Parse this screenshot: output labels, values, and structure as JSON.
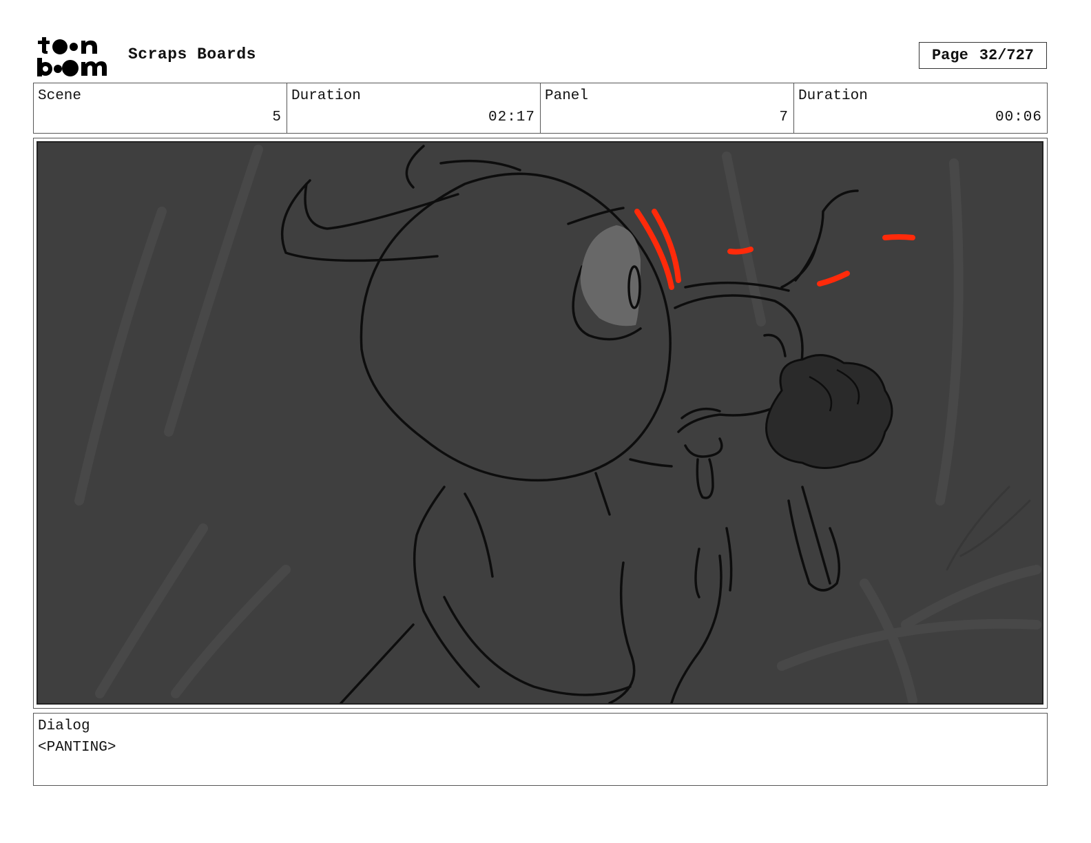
{
  "header": {
    "logo_text_top": "toon",
    "logo_text_bottom": "boom",
    "project_title": "Scraps Boards",
    "page_label": "Page",
    "page_value": "32/727"
  },
  "info": {
    "scene_label": "Scene",
    "scene_value": "5",
    "scene_duration_label": "Duration",
    "scene_duration_value": "02:17",
    "panel_label": "Panel",
    "panel_value": "7",
    "panel_duration_label": "Duration",
    "panel_duration_value": "00:06"
  },
  "dialog": {
    "label": "Dialog",
    "text": "<PANTING>"
  },
  "colors": {
    "panel_background": "#3f3f3f",
    "sketch_line": "#0d0d0d",
    "accent_red": "#ff2a0a",
    "eye_fill": "#6a6a6a"
  }
}
